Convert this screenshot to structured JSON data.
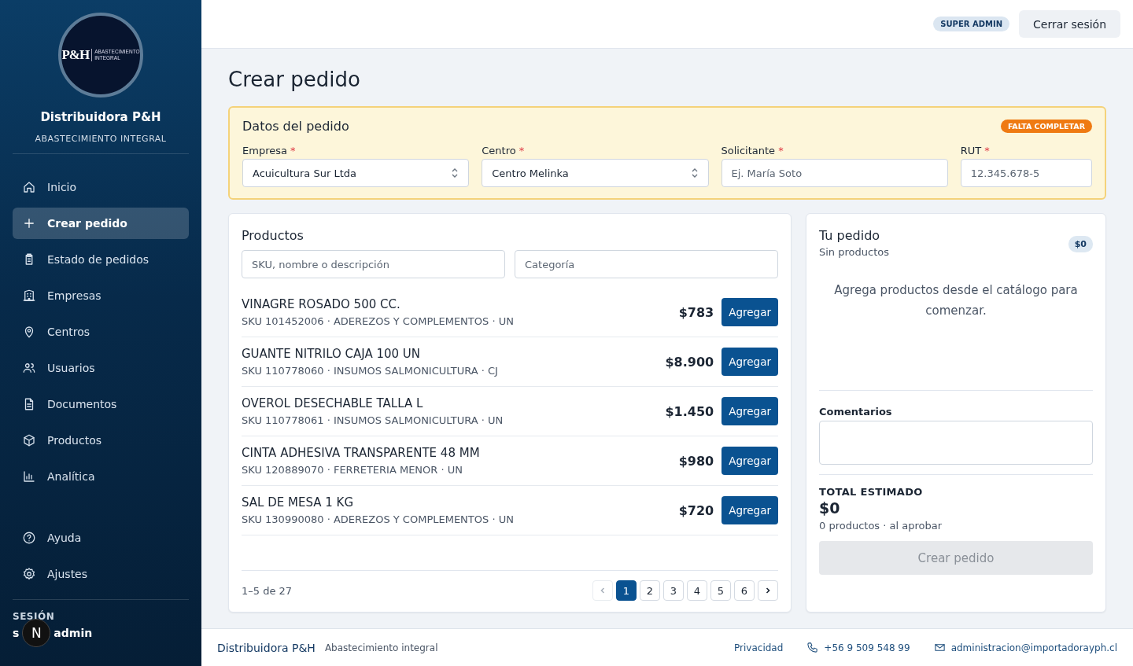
{
  "sidebar": {
    "logo": {
      "mark": "P&H",
      "tagline_lines": [
        "ABASTECIMIENTO",
        "INTEGRAL"
      ]
    },
    "company": "Distribuidora P&H",
    "tagline": "ABASTECIMIENTO INTEGRAL",
    "items": [
      {
        "label": "Inicio",
        "kind": "home",
        "selected": false
      },
      {
        "label": "Crear pedido",
        "kind": "create",
        "selected": true
      },
      {
        "label": "Estado de pedidos",
        "kind": "status",
        "selected": false
      },
      {
        "label": "Empresas",
        "kind": "companies",
        "selected": false
      },
      {
        "label": "Centros",
        "kind": "centers",
        "selected": false
      },
      {
        "label": "Usuarios",
        "kind": "users",
        "selected": false
      },
      {
        "label": "Documentos",
        "kind": "documents",
        "selected": false
      },
      {
        "label": "Productos",
        "kind": "products",
        "selected": false
      },
      {
        "label": "Analítica",
        "kind": "analytics",
        "selected": false
      }
    ],
    "bottom_items": [
      {
        "label": "Ayuda",
        "kind": "help",
        "selected": false
      },
      {
        "label": "Ajustes",
        "kind": "settings",
        "selected": false
      }
    ],
    "session": {
      "label": "SESIÓN",
      "user_start": "s",
      "user_end": "admin",
      "overlay_badge": "N"
    }
  },
  "header": {
    "role_badge": "SUPER ADMIN",
    "logout": "Cerrar sesión"
  },
  "page_title": "Crear pedido",
  "order_data": {
    "title": "Datos del pedido",
    "status_badge": "FALTA COMPLETAR",
    "fields": [
      {
        "label": "Empresa",
        "required_mark": "*",
        "kind": "select",
        "value": "Acuicultura Sur Ltda"
      },
      {
        "label": "Centro",
        "required_mark": "*",
        "kind": "select",
        "value": "Centro Melinka"
      },
      {
        "label": "Solicitante",
        "required_mark": "*",
        "kind": "text",
        "placeholder": "Ej. María Soto"
      },
      {
        "label": "RUT",
        "required_mark": "*",
        "kind": "text",
        "placeholder": "12.345.678-5"
      }
    ]
  },
  "products": {
    "title": "Productos",
    "search": {
      "placeholder": "SKU, nombre o descripción"
    },
    "category": {
      "placeholder": "Categoría"
    },
    "rows": [
      {
        "name": "VINAGRE ROSADO 500 CC.",
        "details": "SKU 101452006 · ADEREZOS Y COMPLEMENTOS · UN",
        "price": "$783",
        "action": "Agregar"
      },
      {
        "name": "GUANTE NITRILO CAJA 100 UN",
        "details": "SKU 110778060 · INSUMOS SALMONICULTURA · CJ",
        "price": "$8.900",
        "action": "Agregar"
      },
      {
        "name": "OVEROL DESECHABLE TALLA L",
        "details": "SKU 110778061 · INSUMOS SALMONICULTURA · UN",
        "price": "$1.450",
        "action": "Agregar"
      },
      {
        "name": "CINTA ADHESIVA TRANSPARENTE 48 MM",
        "details": "SKU 120889070 · FERRETERIA MENOR · UN",
        "price": "$980",
        "action": "Agregar"
      },
      {
        "name": "SAL DE MESA 1 KG",
        "details": "SKU 130990080 · ADEREZOS Y COMPLEMENTOS · UN",
        "price": "$720",
        "action": "Agregar"
      }
    ],
    "range": "1–5 de 27",
    "prev_disabled": true,
    "pages": [
      {
        "label": "1",
        "selected": true
      },
      {
        "label": "2",
        "selected": false
      },
      {
        "label": "3",
        "selected": false
      },
      {
        "label": "4",
        "selected": false
      },
      {
        "label": "5",
        "selected": false
      },
      {
        "label": "6",
        "selected": false
      }
    ]
  },
  "cart": {
    "title": "Tu pedido",
    "subtitle": "Sin productos",
    "total_badge": "$0",
    "empty_message": "Agrega productos desde el catálogo para comenzar.",
    "comments_label": "Comentarios",
    "total_label": "TOTAL ESTIMADO",
    "total": "$0",
    "summary": "0 productos · al aprobar",
    "submit": {
      "label": "Crear pedido",
      "disabled": true
    }
  },
  "footer": {
    "brand": "Distribuidora P&H",
    "tagline": "Abastecimiento integral",
    "privacy": "Privacidad",
    "phone": "+56 9 509 548 99",
    "email": "administracion@importadorayph.cl"
  }
}
